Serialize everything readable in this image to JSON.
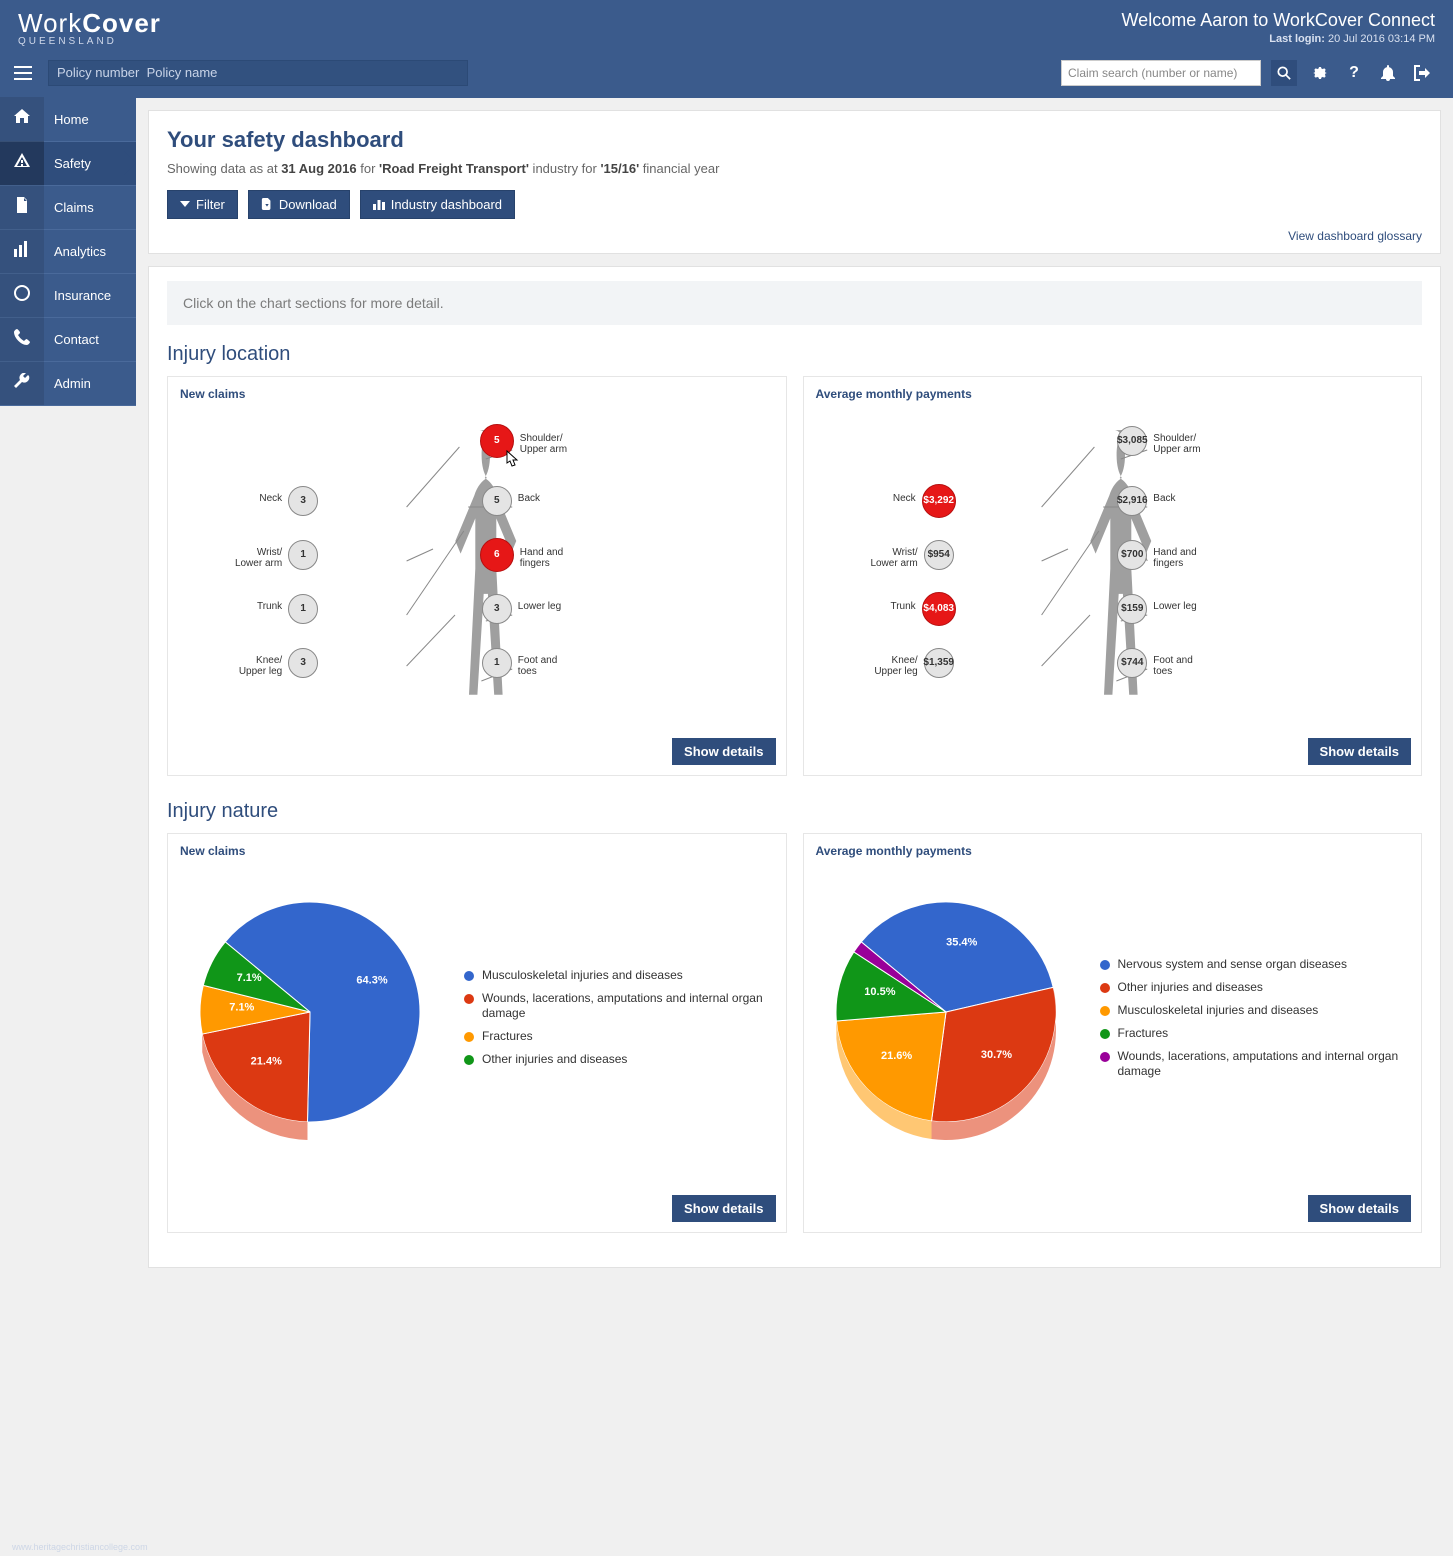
{
  "brand": {
    "word1": "Work",
    "word2": "Cover",
    "sub": "QUEENSLAND"
  },
  "welcome": "Welcome Aaron to WorkCover Connect",
  "last_login_label": "Last login:",
  "last_login_value": "20 Jul 2016 03:14 PM",
  "policy_placeholder": "Policy number  Policy name",
  "claim_search_placeholder": "Claim search (number or name)",
  "sidebar": {
    "items": [
      {
        "label": "Home",
        "icon": "home"
      },
      {
        "label": "Safety",
        "icon": "warning",
        "active": true
      },
      {
        "label": "Claims",
        "icon": "file"
      },
      {
        "label": "Analytics",
        "icon": "bars"
      },
      {
        "label": "Insurance",
        "icon": "shield"
      },
      {
        "label": "Contact",
        "icon": "phone"
      },
      {
        "label": "Admin",
        "icon": "wrench"
      }
    ]
  },
  "page": {
    "title": "Your safety dashboard",
    "subtitle_pre": "Showing data as at ",
    "subtitle_date": "31 Aug 2016",
    "subtitle_mid1": " for ",
    "subtitle_industry": "'Road Freight Transport'",
    "subtitle_mid2": " industry for ",
    "subtitle_fy": "'15/16'",
    "subtitle_post": " financial year",
    "btn_filter": "Filter",
    "btn_download": "Download",
    "btn_industry": "Industry dashboard",
    "glossary_link": "View dashboard glossary",
    "info_banner": "Click on the chart sections for more detail."
  },
  "injury_location": {
    "title": "Injury location",
    "left_title": "New claims",
    "right_title": "Average monthly payments",
    "show_details": "Show details",
    "left_points": {
      "shoulder": {
        "value": "5",
        "label_line1": "Shoulder/",
        "label_line2": "Upper arm",
        "hot": true
      },
      "back": {
        "value": "5",
        "label": "Back"
      },
      "hand": {
        "value": "6",
        "label_line1": "Hand and",
        "label_line2": "fingers",
        "hot": true
      },
      "lowerleg": {
        "value": "3",
        "label": "Lower leg"
      },
      "foot": {
        "value": "1",
        "label_line1": "Foot and",
        "label_line2": "toes"
      },
      "neck": {
        "value": "3",
        "label": "Neck"
      },
      "wrist": {
        "value": "1",
        "label_line1": "Wrist/",
        "label_line2": "Lower arm"
      },
      "trunk": {
        "value": "1",
        "label": "Trunk"
      },
      "knee": {
        "value": "3",
        "label_line1": "Knee/",
        "label_line2": "Upper leg"
      }
    },
    "right_points": {
      "shoulder": {
        "value": "$3,085",
        "label_line1": "Shoulder/",
        "label_line2": "Upper arm"
      },
      "back": {
        "value": "$2,916",
        "label": "Back"
      },
      "hand": {
        "value": "$700",
        "label_line1": "Hand and",
        "label_line2": "fingers"
      },
      "lowerleg": {
        "value": "$159",
        "label": "Lower leg"
      },
      "foot": {
        "value": "$744",
        "label_line1": "Foot and",
        "label_line2": "toes"
      },
      "neck": {
        "value": "$3,292",
        "label": "Neck",
        "hot": true
      },
      "wrist": {
        "value": "$954",
        "label_line1": "Wrist/",
        "label_line2": "Lower arm"
      },
      "trunk": {
        "value": "$4,083",
        "label": "Trunk",
        "hot": true
      },
      "knee": {
        "value": "$1,359",
        "label_line1": "Knee/",
        "label_line2": "Upper leg"
      }
    }
  },
  "injury_nature": {
    "title": "Injury nature",
    "left_title": "New claims",
    "right_title": "Average monthly payments",
    "show_details": "Show details"
  },
  "chart_data": [
    {
      "id": "injury_nature_new_claims",
      "type": "pie",
      "title": "New claims",
      "series": [
        {
          "name": "Musculoskeletal injuries and diseases",
          "value": 64.3,
          "color": "#3366cc"
        },
        {
          "name": "Wounds, lacerations, amputations and internal organ damage",
          "value": 21.4,
          "color": "#dc3912"
        },
        {
          "name": "Fractures",
          "value": 7.1,
          "color": "#ff9900"
        },
        {
          "name": "Other injuries and diseases",
          "value": 7.1,
          "color": "#109618"
        }
      ]
    },
    {
      "id": "injury_nature_avg_monthly_payments",
      "type": "pie",
      "title": "Average monthly payments",
      "series": [
        {
          "name": "Nervous system and sense organ diseases",
          "value": 35.4,
          "color": "#3366cc"
        },
        {
          "name": "Other injuries and diseases",
          "value": 30.7,
          "color": "#dc3912"
        },
        {
          "name": "Musculoskeletal injuries and diseases",
          "value": 21.6,
          "color": "#ff9900"
        },
        {
          "name": "Fractures",
          "value": 10.5,
          "color": "#109618"
        },
        {
          "name": "Wounds, lacerations, amputations and internal organ damage",
          "value": 1.8,
          "color": "#990099"
        }
      ]
    }
  ],
  "colors": {
    "primary": "#2f4d7c",
    "header": "#3b5b8c",
    "hot": "#e61717"
  },
  "watermark": "www.heritagechristiancollege.com"
}
